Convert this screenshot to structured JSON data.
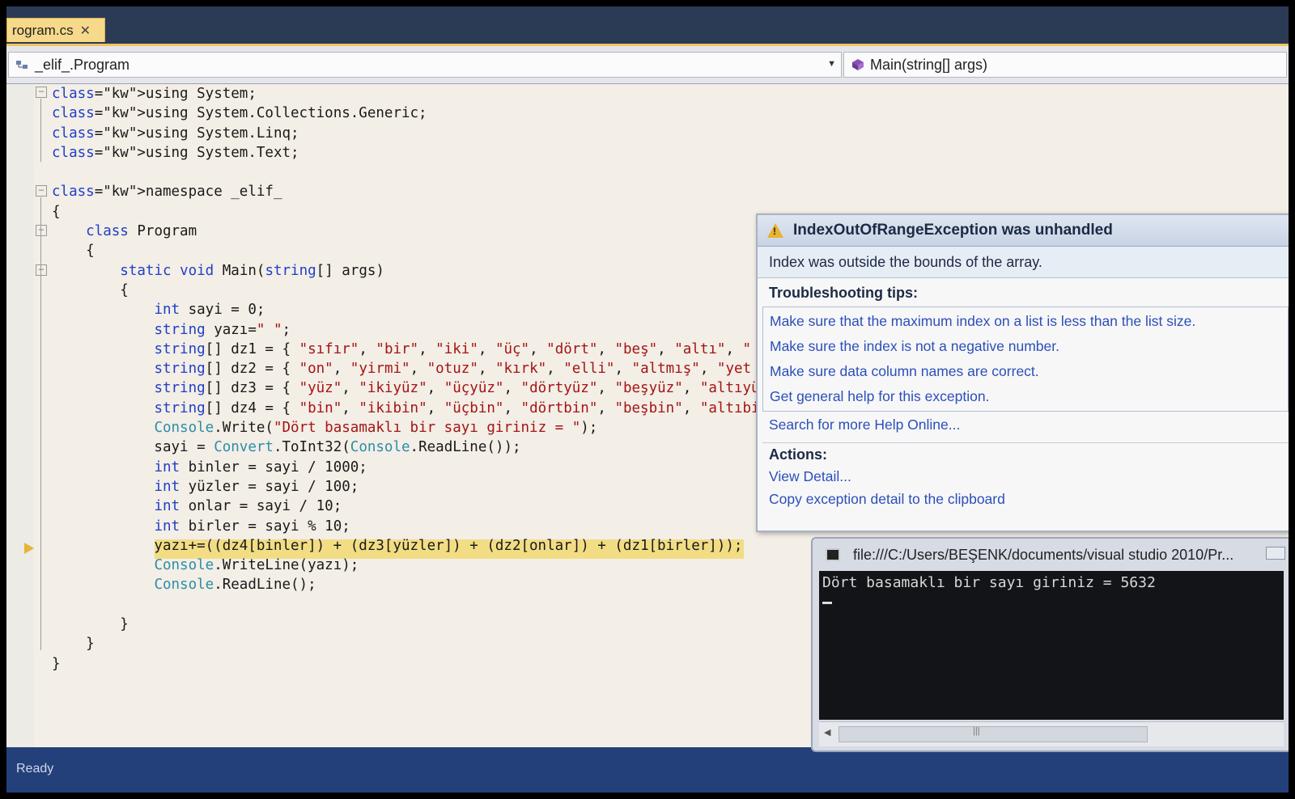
{
  "tab": {
    "label": "rogram.cs",
    "close": "✕"
  },
  "nav": {
    "class_combo": "_elif_.Program",
    "method_combo": "Main(string[] args)"
  },
  "code_lines": [
    "using System;",
    "using System.Collections.Generic;",
    "using System.Linq;",
    "using System.Text;",
    "",
    "namespace _elif_",
    "{",
    "    class Program",
    "    {",
    "        static void Main(string[] args)",
    "        {",
    "            int sayi = 0;",
    "            string yazı=\" \";",
    "            string[] dz1 = { \"sıfır\", \"bir\", \"iki\", \"üç\", \"dört\", \"beş\", \"altı\", \"",
    "            string[] dz2 = { \"on\", \"yirmi\", \"otuz\", \"kırk\", \"elli\", \"altmış\", \"yet",
    "            string[] dz3 = { \"yüz\", \"ikiyüz\", \"üçyüz\", \"dörtyüz\", \"beşyüz\", \"altıyü",
    "            string[] dz4 = { \"bin\", \"ikibin\", \"üçbin\", \"dörtbin\", \"beşbin\", \"altıbi",
    "            Console.Write(\"Dört basamaklı bir sayı giriniz = \");",
    "            sayi = Convert.ToInt32(Console.ReadLine());",
    "            int binler = sayi / 1000;",
    "            int yüzler = sayi / 100;",
    "            int onlar = sayi / 10;",
    "            int birler = sayi % 10;",
    "            yazı+=((dz4[binler]) + (dz3[yüzler]) + (dz2[onlar]) + (dz1[birler]));",
    "            Console.WriteLine(yazı);",
    "            Console.ReadLine();",
    "",
    "        }",
    "    }",
    "}"
  ],
  "exception": {
    "title": "IndexOutOfRangeException was unhandled",
    "message": "Index was outside the bounds of the array.",
    "tips_heading": "Troubleshooting tips:",
    "tips": [
      "Make sure that the maximum index on a list is less than the list size.",
      "Make sure the index is not a negative number.",
      "Make sure data column names are correct.",
      "Get general help for this exception."
    ],
    "search_link": "Search for more Help Online...",
    "actions_heading": "Actions:",
    "actions": [
      "View Detail...",
      "Copy exception detail to the clipboard"
    ]
  },
  "console": {
    "title": "file:///C:/Users/BEŞENK/documents/visual studio 2010/Pr...",
    "output": "Dört basamaklı bir sayı giriniz = 5632"
  },
  "status": {
    "text": "Ready"
  },
  "colors": {
    "keyword": "#1f3fc8",
    "type": "#2b8ea7",
    "string": "#a31515",
    "highlight": "#f2dd84",
    "link": "#2b4fb8",
    "tab_active": "#f6d98a"
  }
}
